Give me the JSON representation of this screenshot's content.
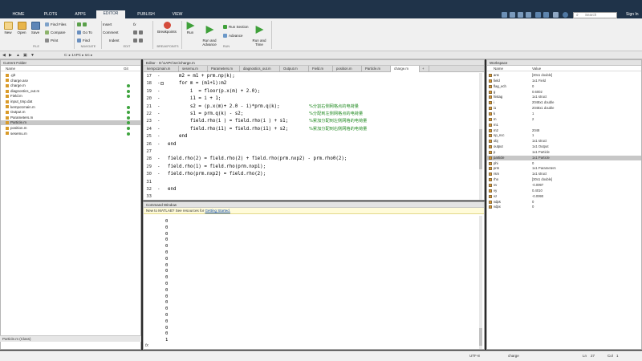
{
  "tabs": [
    {
      "label": "HOME",
      "active": false
    },
    {
      "label": "PLOTS",
      "active": false
    },
    {
      "label": "APPS",
      "active": false
    },
    {
      "label": "EDITOR",
      "active": true
    },
    {
      "label": "PUBLISH",
      "active": false
    },
    {
      "label": "VIEW",
      "active": false
    }
  ],
  "search_placeholder": "Search Documentation",
  "signin_label": "Sign In",
  "ribbon": {
    "file": {
      "new": "New",
      "open": "Open",
      "save": "Save",
      "find_files": "Find Files",
      "compare": "Compare",
      "print": "Print",
      "group": "FILE"
    },
    "navigate": {
      "goto": "Go To",
      "find": "Find",
      "group": "NAVIGATE"
    },
    "edit": {
      "insert": "Insert",
      "comment": "Comment",
      "indent": "Indent",
      "fx": "fx",
      "group": "EDIT"
    },
    "breakpoints": {
      "label": "Breakpoints",
      "group": "BREAKPOINTS"
    },
    "run": {
      "run": "Run",
      "run_advance": "Run and\nAdvance",
      "run_section": "Run Section",
      "advance": "Advance",
      "run_time": "Run and\nTime",
      "group": "RUN"
    }
  },
  "address_path": "C: ▸ 1APC ▸ src ▸",
  "current_folder": {
    "title": "Current Folder",
    "col_name": "Name",
    "col_git": "Git",
    "files": [
      {
        "name": ".git",
        "selected": false,
        "status": ""
      },
      {
        "name": "charge.asv",
        "selected": false,
        "status": ""
      },
      {
        "name": "charge.m",
        "selected": false,
        "status": "ok"
      },
      {
        "name": "diagnostics_out.m",
        "selected": false,
        "status": "ok"
      },
      {
        "name": "Field.m",
        "selected": false,
        "status": "ok"
      },
      {
        "name": "input_tmp.dat",
        "selected": false,
        "status": ""
      },
      {
        "name": "kempo1main.m",
        "selected": false,
        "status": "ok"
      },
      {
        "name": "Output.m",
        "selected": false,
        "status": "ok"
      },
      {
        "name": "Parameters.m",
        "selected": false,
        "status": "ok"
      },
      {
        "name": "Particle.m",
        "selected": true,
        "status": "ok"
      },
      {
        "name": "position.m",
        "selected": false,
        "status": "ok"
      },
      {
        "name": "sesemu.m",
        "selected": false,
        "status": "ok"
      }
    ],
    "detail": "Particle.m (Class)"
  },
  "editor": {
    "title": "Editor - G:\\1APC\\src\\charge.m",
    "tabs": [
      "kempo1main.m",
      "sesemu.m",
      "Parameters.m",
      "diagnostics_out.m",
      "Output.m",
      "Field.m",
      "position.m",
      "Particle.m",
      "charge.m"
    ],
    "active_tab": "charge.m",
    "lines": [
      {
        "n": "17",
        "dash": "-",
        "text": "    m2 = m1 + prm.np(k);"
      },
      {
        "n": "18",
        "dash": "-",
        "text": "    for m = (m1+1):m2",
        "kw": true,
        "fold": true
      },
      {
        "n": "19",
        "dash": "-",
        "text": "        i  = floor(p.x(m) + 2.0);"
      },
      {
        "n": "20",
        "dash": "-",
        "text": "        i1 = i + 1;"
      },
      {
        "n": "21",
        "dash": "-",
        "text": "        s2 = (p.x(m)+ 2.0 - i)*prm.q(k);",
        "comment": "%分割右侧网格点的电荷量"
      },
      {
        "n": "22",
        "dash": "-",
        "text": "        s1 = prm.q(k) - s2;",
        "comment": "%分配到左侧网格点的电荷量"
      },
      {
        "n": "23",
        "dash": "-",
        "text": "        field.rho(i ) = field.rho(i ) + s1;",
        "comment": "%累加分配到左侧网格的电荷量"
      },
      {
        "n": "24",
        "dash": "-",
        "text": "        field.rho(i1) = field.rho(i1) + s2;",
        "comment": "%累加分配到右侧网格的电荷量"
      },
      {
        "n": "25",
        "dash": "-",
        "text": "    end",
        "kw": true
      },
      {
        "n": "26",
        "dash": "-",
        "text": "end",
        "kw": true
      },
      {
        "n": "27",
        "dash": "",
        "text": ""
      },
      {
        "n": "28",
        "dash": "-",
        "text": "field.rho(2) = field.rho(2) + field.rho(prm.nxp2) - prm.rho0(2);"
      },
      {
        "n": "29",
        "dash": "-",
        "text": "field.rho(1) = field.rho(prm.nxp1);"
      },
      {
        "n": "30",
        "dash": "-",
        "text": "field.rho(prm.nxp2) = field.rho(2);"
      },
      {
        "n": "31",
        "dash": "",
        "text": ""
      },
      {
        "n": "32",
        "dash": "-",
        "text": "end",
        "kw": true
      },
      {
        "n": "33",
        "dash": "",
        "text": ""
      }
    ]
  },
  "command_window": {
    "title": "Command Window",
    "info_text": "New to MATLAB? See resources for ",
    "info_link": "Getting Started.",
    "output": [
      "0",
      "0",
      "0",
      "0",
      "0",
      "0",
      "0",
      "0",
      "0",
      "0",
      "0",
      "0",
      "0",
      "0",
      "0",
      "0",
      "0",
      "0",
      "0",
      "1"
    ],
    "prompt": "fx"
  },
  "workspace": {
    "title": "Workspace",
    "col_name": "Name",
    "col_value": "Value",
    "vars": [
      {
        "name": "ans",
        "value": "[30x1 double]",
        "selected": false
      },
      {
        "name": "field",
        "value": "1x1 Field",
        "selected": false
      },
      {
        "name": "flag_ech",
        "value": "0",
        "selected": false
      },
      {
        "name": "g",
        "value": "0.6002",
        "selected": false
      },
      {
        "name": "histag",
        "value": "1x1 struct",
        "selected": false
      },
      {
        "name": "i",
        "value": "2048x1 double",
        "selected": false
      },
      {
        "name": "i1",
        "value": "2048x1 double",
        "selected": false
      },
      {
        "name": "k",
        "value": "1",
        "selected": false
      },
      {
        "name": "m",
        "value": "2",
        "selected": false
      },
      {
        "name": "m1",
        "value": "",
        "selected": false
      },
      {
        "name": "m2",
        "value": "2048",
        "selected": false
      },
      {
        "name": "np_ncc",
        "value": "1",
        "selected": false
      },
      {
        "name": "obj",
        "value": "1x1 struct",
        "selected": false
      },
      {
        "name": "output",
        "value": "1x1 Output",
        "selected": false
      },
      {
        "name": "p",
        "value": "1x1 Particle",
        "selected": false
      },
      {
        "name": "particle",
        "value": "1x1 Particle",
        "selected": true
      },
      {
        "name": "phi",
        "value": "0",
        "selected": false
      },
      {
        "name": "prm",
        "value": "1x1 Parameters",
        "selected": false
      },
      {
        "name": "rsm",
        "value": "1x1 struct",
        "selected": false
      },
      {
        "name": "rho",
        "value": "[30x1 double]",
        "selected": false
      },
      {
        "name": "vv",
        "value": "-0.0997",
        "selected": false
      },
      {
        "name": "vy",
        "value": "0.4010",
        "selected": false
      },
      {
        "name": "vz",
        "value": "-0.0990",
        "selected": false
      },
      {
        "name": "vdps",
        "value": "0",
        "selected": false
      },
      {
        "name": "vdpx",
        "value": "0",
        "selected": false
      }
    ]
  },
  "status": {
    "encoding": "UTF-8",
    "script": "charge",
    "ln_label": "Ln",
    "ln": "27",
    "col_label": "Col",
    "col": "1"
  },
  "colors": {
    "accent": "#1f3349",
    "ribbon_bg": "#f0f0f0",
    "selected_row": "#c7c7c7",
    "keyword": "#0000ff",
    "comment": "#228b22"
  }
}
